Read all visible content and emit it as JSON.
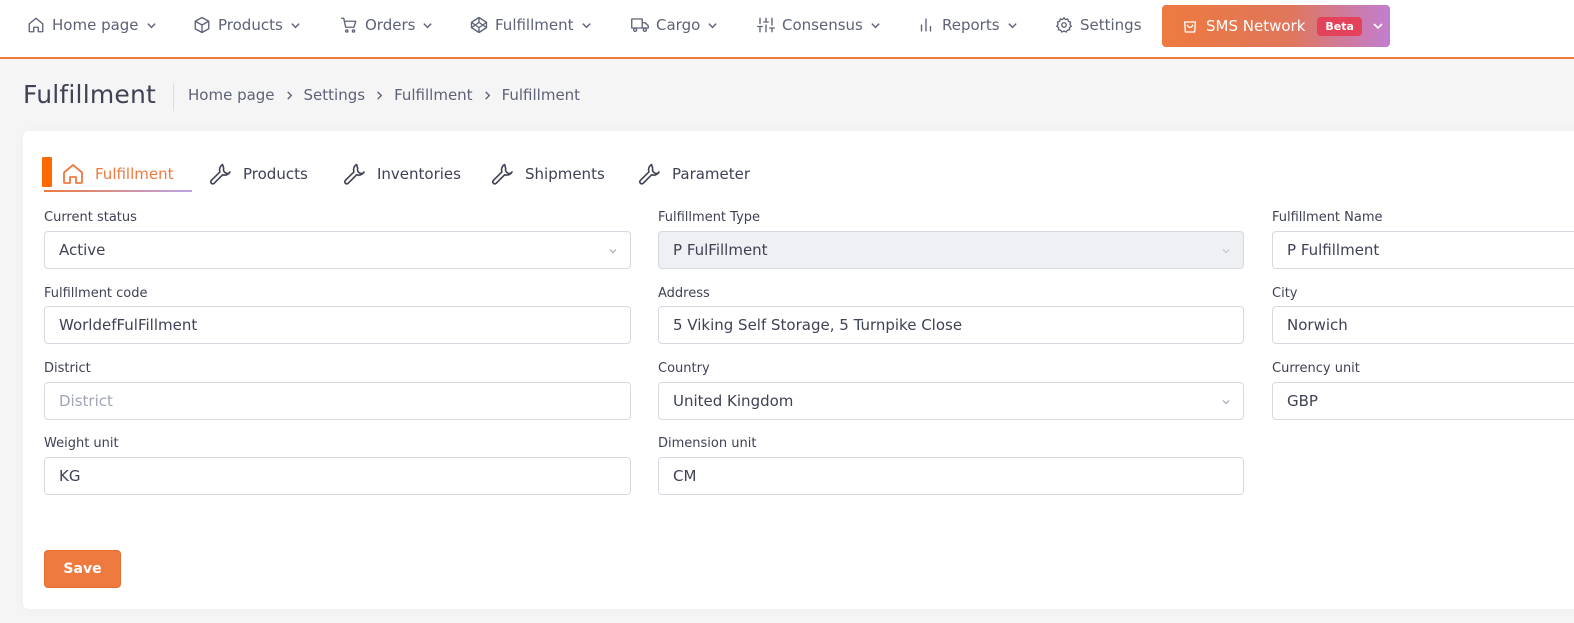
{
  "nav": {
    "items": [
      {
        "label": "Home page",
        "icon": "home-icon"
      },
      {
        "label": "Products",
        "icon": "box-icon"
      },
      {
        "label": "Orders",
        "icon": "cart-icon"
      },
      {
        "label": "Fulfillment",
        "icon": "codepen-icon"
      },
      {
        "label": "Cargo",
        "icon": "truck-icon"
      },
      {
        "label": "Consensus",
        "icon": "sliders-icon"
      },
      {
        "label": "Reports",
        "icon": "bar-chart-icon"
      },
      {
        "label": "Settings",
        "icon": "gear-icon"
      }
    ],
    "sms_label": "SMS Network",
    "beta_label": "Beta"
  },
  "page": {
    "title": "Fulfillment",
    "breadcrumb": [
      "Home page",
      "Settings",
      "Fulfillment",
      "Fulfillment"
    ]
  },
  "tabs": [
    {
      "label": "Fulfillment",
      "icon": "home-icon",
      "active": true
    },
    {
      "label": "Products",
      "icon": "wrench-icon"
    },
    {
      "label": "Inventories",
      "icon": "wrench-icon"
    },
    {
      "label": "Shipments",
      "icon": "wrench-icon"
    },
    {
      "label": "Parameter",
      "icon": "wrench-icon"
    }
  ],
  "form": {
    "current_status": {
      "label": "Current status",
      "value": "Active"
    },
    "fulfillment_type": {
      "label": "Fulfillment Type",
      "value": "P FulFillment"
    },
    "fulfillment_name": {
      "label": "Fulfillment Name",
      "value": "P Fulfillment"
    },
    "fulfillment_code": {
      "label": "Fulfillment code",
      "value": "WorldefFulFillment"
    },
    "address": {
      "label": "Address",
      "value": "5 Viking Self Storage, 5 Turnpike Close"
    },
    "city": {
      "label": "City",
      "value": "Norwich"
    },
    "district": {
      "label": "District",
      "placeholder": "District"
    },
    "country": {
      "label": "Country",
      "value": "United Kingdom"
    },
    "currency_unit": {
      "label": "Currency unit",
      "value": "GBP"
    },
    "weight_unit": {
      "label": "Weight unit",
      "value": "KG"
    },
    "dimension_unit": {
      "label": "Dimension unit",
      "value": "CM"
    },
    "save_label": "Save"
  },
  "colors": {
    "accent": "#ee7a3f",
    "tab_marker": "#ff6a00",
    "beta_badge": "#e3425a"
  }
}
